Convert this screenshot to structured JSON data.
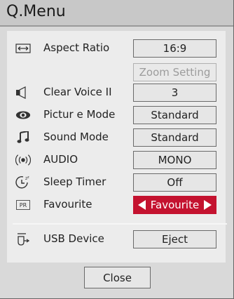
{
  "title": "Q.Menu",
  "menu": {
    "aspect_ratio": {
      "label": "Aspect  Ratio",
      "value": "16:9"
    },
    "zoom_setting": {
      "value": "Zoom  Setting"
    },
    "clear_voice": {
      "label": "Clear  Voice  II",
      "value": "3"
    },
    "picture_mode": {
      "label": "Pictur e  Mode",
      "value": "Standard"
    },
    "sound_mode": {
      "label": "Sound  Mode",
      "value": "Standard"
    },
    "audio": {
      "label": "AUDIO",
      "value": "MONO"
    },
    "sleep_timer": {
      "label": "Sleep  Timer",
      "value": "Off"
    },
    "favourite": {
      "label": "Favourite",
      "value": "Favourite",
      "pr_icon_text": "PR"
    },
    "usb_device": {
      "label": "USB  Device",
      "value": "Eject"
    }
  },
  "close_label": "Close",
  "colors": {
    "accent": "#c4122f",
    "panel": "#ececec",
    "frame": "#d9d9d9"
  }
}
